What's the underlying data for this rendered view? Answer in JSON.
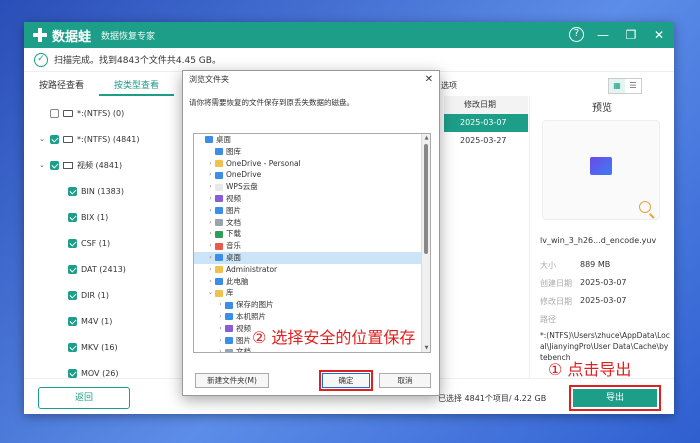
{
  "app": {
    "name": "数据蛙",
    "subtitle": "数据恢复专家",
    "help_icon": "?",
    "min_icon": "—",
    "restore_icon": "❐",
    "close_icon": "✕"
  },
  "status": {
    "text": "扫描完成。找到4843个文件共4.45 GB。"
  },
  "tabs": [
    {
      "label": "按路径查看"
    },
    {
      "label": "按类型查看"
    }
  ],
  "partial_tab": "选项",
  "tree": [
    {
      "label": "*:(NTFS) (0)",
      "checked": false
    },
    {
      "label": "*:(NTFS) (4841)",
      "checked": true
    },
    {
      "label": "视频 (4841)",
      "checked": true
    },
    {
      "label": "BIN (1383)",
      "checked": true
    },
    {
      "label": "BIX (1)",
      "checked": true
    },
    {
      "label": "CSF (1)",
      "checked": true
    },
    {
      "label": "DAT (2413)",
      "checked": true
    },
    {
      "label": "DIR (1)",
      "checked": true
    },
    {
      "label": "M4V (1)",
      "checked": true
    },
    {
      "label": "MKV (16)",
      "checked": true
    },
    {
      "label": "MOV (26)",
      "checked": true
    }
  ],
  "table": {
    "header_date": "修改日期",
    "dates": [
      "2025-03-07",
      "2025-03-27"
    ]
  },
  "preview": {
    "title": "预览",
    "filename": "lv_win_3_h26...d_encode.yuv",
    "size_label": "大小",
    "size": "889 MB",
    "created_label": "创建日期",
    "created": "2025-03-07",
    "modified_label": "修改日期",
    "modified": "2025-03-07",
    "path_label": "路径",
    "path": "*:(NTFS)\\Users\\zhuce\\AppData\\Local\\JianyingPro\\User Data\\Cache\\bytebench"
  },
  "bottom": {
    "back_label": "返回",
    "selected_text": "已选择 4841个项目/ 4.22 GB",
    "export_label": "导出"
  },
  "annotations": {
    "step1": "① 点击导出",
    "step2": "② 选择安全的位置保存"
  },
  "dialog": {
    "title": "浏览文件夹",
    "close_icon": "✕",
    "message": "请你将需要恢复的文件保存到原丢失数据的磁盘。",
    "items": [
      {
        "label": "桌面",
        "indent": 0,
        "chev": "",
        "color": "#3b8ee8"
      },
      {
        "label": "图库",
        "indent": 1,
        "chev": "",
        "color": "#3b8ee8"
      },
      {
        "label": "OneDrive - Personal",
        "indent": 1,
        "chev": ">",
        "color": "#f0c14b"
      },
      {
        "label": "OneDrive",
        "indent": 1,
        "chev": ">",
        "color": "#3b8ee8"
      },
      {
        "label": "WPS云盘",
        "indent": 1,
        "chev": ">",
        "color": "#e8e8e8"
      },
      {
        "label": "视频",
        "indent": 1,
        "chev": ">",
        "color": "#8a5cd8"
      },
      {
        "label": "图片",
        "indent": 1,
        "chev": ">",
        "color": "#3b8ee8"
      },
      {
        "label": "文档",
        "indent": 1,
        "chev": ">",
        "color": "#9aa4b0"
      },
      {
        "label": "下载",
        "indent": 1,
        "chev": ">",
        "color": "#2d9e5a"
      },
      {
        "label": "音乐",
        "indent": 1,
        "chev": ">",
        "color": "#e85a4a"
      },
      {
        "label": "桌面",
        "indent": 1,
        "chev": ">",
        "color": "#3b8ee8",
        "selected": true
      },
      {
        "label": "Administrator",
        "indent": 1,
        "chev": ">",
        "color": "#f0c14b"
      },
      {
        "label": "此电脑",
        "indent": 1,
        "chev": ">",
        "color": "#3b8ee8"
      },
      {
        "label": "库",
        "indent": 1,
        "chev": "v",
        "color": "#f0c14b"
      },
      {
        "label": "保存的图片",
        "indent": 2,
        "chev": ">",
        "color": "#3b8ee8"
      },
      {
        "label": "本机照片",
        "indent": 2,
        "chev": ">",
        "color": "#3b8ee8"
      },
      {
        "label": "视频",
        "indent": 2,
        "chev": ">",
        "color": "#8a5cd8"
      },
      {
        "label": "图片",
        "indent": 2,
        "chev": ">",
        "color": "#3b8ee8"
      },
      {
        "label": "文档",
        "indent": 2,
        "chev": ">",
        "color": "#9aa4b0"
      }
    ],
    "new_folder_label": "新建文件夹(M)",
    "ok_label": "确定",
    "cancel_label": "取消"
  }
}
